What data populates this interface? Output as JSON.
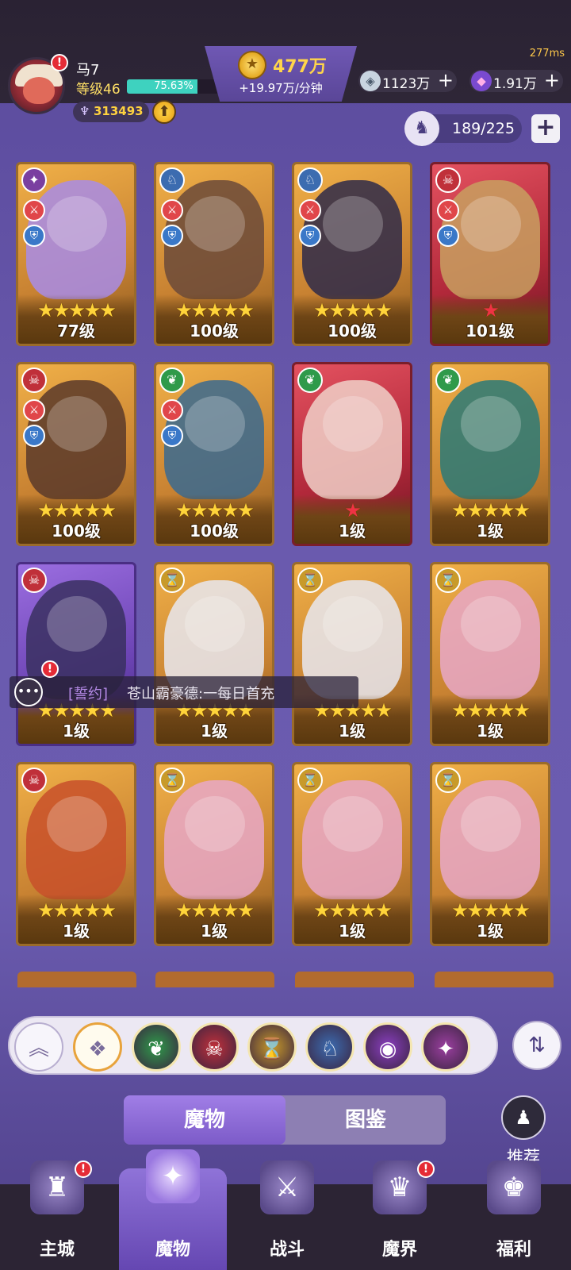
{
  "status": {
    "ping": "277ms"
  },
  "player": {
    "name": "马7",
    "level_label": "等级46",
    "exp_percent_text": "75.63%",
    "exp_fraction": 0.7563,
    "power": "313493",
    "avatar_badge": "!"
  },
  "currency": {
    "gold_amount": "477万",
    "gold_rate": "+19.97万/分钟",
    "gem1_value": "1123万",
    "gem2_value": "1.91万",
    "plus_symbol": "+"
  },
  "collection": {
    "count": "189/225",
    "plus": "+"
  },
  "cards": [
    {
      "level": "77级",
      "stars": "★★★★★",
      "star_color": "gold",
      "frame": "gold",
      "element_icon": "vortex-icon",
      "element_color": "#7a3fa0",
      "art": "#a88ce8",
      "roles": true
    },
    {
      "level": "100级",
      "stars": "★★★★★",
      "star_color": "gold",
      "frame": "gold",
      "element_icon": "dragon-icon",
      "element_color": "#3c6cb0",
      "art": "#6b4a3a",
      "roles": true
    },
    {
      "level": "100级",
      "stars": "★★★★★",
      "star_color": "gold",
      "frame": "gold",
      "element_icon": "dragon-icon",
      "element_color": "#3c6cb0",
      "art": "#2e2a4a",
      "roles": true
    },
    {
      "level": "101级",
      "stars": "★",
      "star_color": "red",
      "frame": "red",
      "element_icon": "demon-icon",
      "element_color": "#c0303a",
      "art": "#c8a060",
      "roles": true
    },
    {
      "level": "100级",
      "stars": "★★★★★",
      "star_color": "gold",
      "frame": "gold",
      "element_icon": "demon-icon",
      "element_color": "#c0303a",
      "art": "#5a3a2a",
      "roles": true
    },
    {
      "level": "100级",
      "stars": "★★★★★",
      "star_color": "gold",
      "frame": "gold",
      "element_icon": "leaf-icon",
      "element_color": "#2f9a4a",
      "art": "#3a6a90",
      "roles": true
    },
    {
      "level": "1级",
      "stars": "★",
      "star_color": "red",
      "frame": "red",
      "element_icon": "leaf-icon",
      "element_color": "#2f9a4a",
      "art": "#f0d0c8",
      "roles": false
    },
    {
      "level": "1级",
      "stars": "★★★★★",
      "star_color": "gold",
      "frame": "gold",
      "element_icon": "leaf-icon",
      "element_color": "#2f9a4a",
      "art": "#2a7a78",
      "roles": false
    },
    {
      "level": "1级",
      "stars": "★★★★★",
      "star_color": "gold",
      "frame": "purple",
      "element_icon": "demon-icon",
      "element_color": "#c0303a",
      "art": "#3a3060",
      "roles": false
    },
    {
      "level": "1级",
      "stars": "★★★★★",
      "star_color": "gold",
      "frame": "gold",
      "element_icon": "hourglass-icon",
      "element_color": "#c89a2a",
      "art": "#e8e8f0",
      "roles": false
    },
    {
      "level": "1级",
      "stars": "★★★★★",
      "star_color": "gold",
      "frame": "gold",
      "element_icon": "hourglass-icon",
      "element_color": "#c89a2a",
      "art": "#e8e8f0",
      "roles": false
    },
    {
      "level": "1级",
      "stars": "★★★★★",
      "star_color": "gold",
      "frame": "gold",
      "element_icon": "hourglass-icon",
      "element_color": "#c89a2a",
      "art": "#e8a8c8",
      "roles": false
    },
    {
      "level": "1级",
      "stars": "★★★★★",
      "star_color": "gold",
      "frame": "gold",
      "element_icon": "demon-icon",
      "element_color": "#c0303a",
      "art": "#c8502a",
      "roles": false
    },
    {
      "level": "1级",
      "stars": "★★★★★",
      "star_color": "gold",
      "frame": "gold",
      "element_icon": "hourglass-icon",
      "element_color": "#c89a2a",
      "art": "#e8a8c8",
      "roles": false
    },
    {
      "level": "1级",
      "stars": "★★★★★",
      "star_color": "gold",
      "frame": "gold",
      "element_icon": "hourglass-icon",
      "element_color": "#c89a2a",
      "art": "#e8a8c8",
      "roles": false
    },
    {
      "level": "1级",
      "stars": "★★★★★",
      "star_color": "gold",
      "frame": "gold",
      "element_icon": "hourglass-icon",
      "element_color": "#c89a2a",
      "art": "#e8a8c8",
      "roles": false
    }
  ],
  "chat": {
    "tag": "[誓约]",
    "message": "苍山霸豪德:一每日首充"
  },
  "filters": [
    {
      "name": "filter-leaf-icon",
      "color": "#2f9a4a",
      "glyph": "❦"
    },
    {
      "name": "filter-demon-icon",
      "color": "#c0303a",
      "glyph": "☠"
    },
    {
      "name": "filter-hourglass-icon",
      "color": "#c89a2a",
      "glyph": "⌛"
    },
    {
      "name": "filter-dragon-icon",
      "color": "#3c6cb0",
      "glyph": "♘"
    },
    {
      "name": "filter-eye-icon",
      "color": "#8a3fc0",
      "glyph": "◉"
    },
    {
      "name": "filter-vortex-icon",
      "color": "#9b3fa0",
      "glyph": "✦"
    }
  ],
  "tabs": {
    "monsters": "魔物",
    "codex": "图鉴"
  },
  "recommend": {
    "label": "推荐"
  },
  "nav": [
    {
      "label": "主城",
      "icon": "castle-icon",
      "glyph": "♜",
      "badge": true
    },
    {
      "label": "魔物",
      "icon": "monster-flame-icon",
      "glyph": "✦",
      "badge": false,
      "active": true
    },
    {
      "label": "战斗",
      "icon": "sword-shield-icon",
      "glyph": "⚔",
      "badge": false
    },
    {
      "label": "魔界",
      "icon": "demon-realm-icon",
      "glyph": "♛",
      "badge": true
    },
    {
      "label": "福利",
      "icon": "treasure-chest-icon",
      "glyph": "♚",
      "badge": false
    }
  ]
}
